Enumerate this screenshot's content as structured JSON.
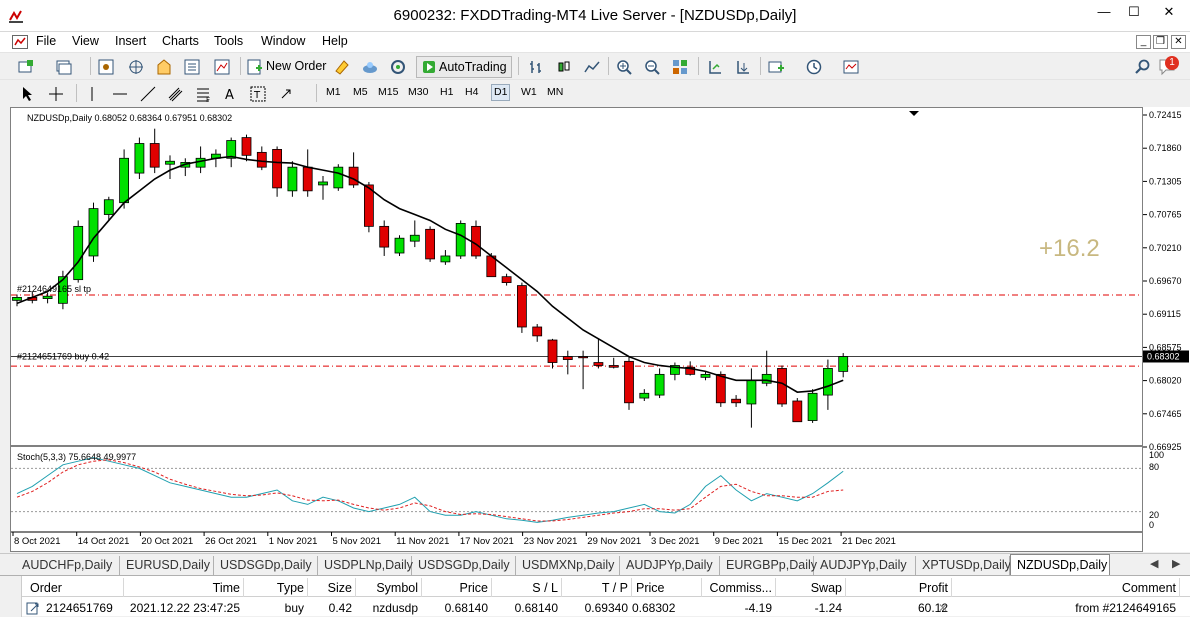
{
  "window": {
    "title": "6900232: FXDDTrading-MT4 Live Server - [NZDUSDp,Daily]",
    "min_label": "—",
    "max_label": "☐",
    "close_label": "✕"
  },
  "menu": [
    "File",
    "View",
    "Insert",
    "Charts",
    "Tools",
    "Window",
    "Help"
  ],
  "toolbar": {
    "new_order": "New Order",
    "auto_trading": "AutoTrading",
    "notification_count": "1"
  },
  "timeframes": [
    "M1",
    "M5",
    "M15",
    "M30",
    "H1",
    "H4",
    "D1",
    "W1",
    "MN"
  ],
  "active_timeframe": "D1",
  "chart": {
    "header": "NZDUSDp,Daily  0.68052 0.68364 0.67951 0.68302",
    "profit_overlay": "+16.2",
    "line_label_1": "#2124649165 sl tp",
    "line_label_2": "#2124651769 buy 0.42",
    "current_price_label": "0.68302",
    "stoch_label": "Stoch(5,3,3) 75.6648 49.9977",
    "price_scale": [
      "0.72415",
      "0.71860",
      "0.71305",
      "0.70765",
      "0.70210",
      "0.69670",
      "0.69115",
      "0.68575",
      "0.68020",
      "0.67465",
      "0.66925"
    ],
    "stoch_scale": [
      "100",
      "80",
      "20",
      "0"
    ],
    "date_labels": [
      "8 Oct 2021",
      "14 Oct 2021",
      "20 Oct 2021",
      "26 Oct 2021",
      "1 Nov 2021",
      "5 Nov 2021",
      "11 Nov 2021",
      "17 Nov 2021",
      "23 Nov 2021",
      "29 Nov 2021",
      "3 Dec 2021",
      "9 Dec 2021",
      "15 Dec 2021",
      "21 Dec 2021"
    ],
    "colors": {
      "bull": "#00e000",
      "bear": "#e00000",
      "ma": "#000000",
      "stoch_main": "#20a0b0",
      "stoch_signal": "#e02020",
      "dashed": "#e00000",
      "overlay": "#c8b880"
    }
  },
  "chart_data": {
    "type": "candlestick",
    "symbol": "NZDUSDp",
    "timeframe": "Daily",
    "ylim": [
      0.66925,
      0.72415
    ],
    "candles": [
      [
        0.6925,
        0.6935,
        0.6915,
        0.693
      ],
      [
        0.693,
        0.694,
        0.692,
        0.6925
      ],
      [
        0.6928,
        0.6938,
        0.692,
        0.6932
      ],
      [
        0.692,
        0.6975,
        0.691,
        0.6965
      ],
      [
        0.696,
        0.706,
        0.6955,
        0.705
      ],
      [
        0.7,
        0.709,
        0.699,
        0.708
      ],
      [
        0.707,
        0.71,
        0.706,
        0.7095
      ],
      [
        0.709,
        0.718,
        0.708,
        0.7165
      ],
      [
        0.714,
        0.72,
        0.713,
        0.719
      ],
      [
        0.719,
        0.7215,
        0.714,
        0.715
      ],
      [
        0.7155,
        0.717,
        0.713,
        0.716
      ],
      [
        0.715,
        0.7165,
        0.7135,
        0.7158
      ],
      [
        0.715,
        0.7185,
        0.714,
        0.7165
      ],
      [
        0.7165,
        0.718,
        0.715,
        0.7172
      ],
      [
        0.7165,
        0.72,
        0.715,
        0.7195
      ],
      [
        0.72,
        0.7205,
        0.716,
        0.717
      ],
      [
        0.7175,
        0.7185,
        0.7145,
        0.715
      ],
      [
        0.718,
        0.7185,
        0.71,
        0.7115
      ],
      [
        0.711,
        0.716,
        0.71,
        0.715
      ],
      [
        0.715,
        0.718,
        0.71,
        0.711
      ],
      [
        0.712,
        0.7135,
        0.7095,
        0.7125
      ],
      [
        0.7115,
        0.7155,
        0.711,
        0.715
      ],
      [
        0.715,
        0.7175,
        0.7115,
        0.712
      ],
      [
        0.712,
        0.7125,
        0.704,
        0.705
      ],
      [
        0.705,
        0.706,
        0.7,
        0.7015
      ],
      [
        0.7005,
        0.7035,
        0.7,
        0.703
      ],
      [
        0.7025,
        0.706,
        0.7015,
        0.7035
      ],
      [
        0.7045,
        0.705,
        0.699,
        0.6995
      ],
      [
        0.699,
        0.701,
        0.6985,
        0.7
      ],
      [
        0.7,
        0.706,
        0.6995,
        0.7055
      ],
      [
        0.705,
        0.706,
        0.6995,
        0.7
      ],
      [
        0.7,
        0.7005,
        0.6965,
        0.6965
      ],
      [
        0.6965,
        0.697,
        0.695,
        0.6955
      ],
      [
        0.695,
        0.6955,
        0.687,
        0.688
      ],
      [
        0.688,
        0.6885,
        0.6855,
        0.6865
      ],
      [
        0.6858,
        0.686,
        0.681,
        0.682
      ],
      [
        0.683,
        0.684,
        0.68,
        0.6825
      ],
      [
        0.683,
        0.684,
        0.6775,
        0.6828
      ],
      [
        0.682,
        0.686,
        0.681,
        0.6815
      ],
      [
        0.6815,
        0.6828,
        0.681,
        0.6812
      ],
      [
        0.6822,
        0.683,
        0.674,
        0.6752
      ],
      [
        0.676,
        0.6775,
        0.6755,
        0.6768
      ],
      [
        0.6765,
        0.681,
        0.676,
        0.68
      ],
      [
        0.68,
        0.682,
        0.679,
        0.6815
      ],
      [
        0.6812,
        0.6822,
        0.6798,
        0.68
      ],
      [
        0.6795,
        0.6805,
        0.679,
        0.68
      ],
      [
        0.68,
        0.6805,
        0.6745,
        0.6752
      ],
      [
        0.6758,
        0.6765,
        0.6745,
        0.6752
      ],
      [
        0.675,
        0.681,
        0.671,
        0.679
      ],
      [
        0.6785,
        0.684,
        0.678,
        0.68
      ],
      [
        0.681,
        0.6815,
        0.6745,
        0.675
      ],
      [
        0.6755,
        0.676,
        0.672,
        0.672
      ],
      [
        0.6722,
        0.6775,
        0.6718,
        0.6768
      ],
      [
        0.6765,
        0.6825,
        0.674,
        0.681
      ],
      [
        0.6805,
        0.6836,
        0.6795,
        0.683
      ]
    ],
    "ma": [
      0.692,
      0.693,
      0.694,
      0.696,
      0.699,
      0.703,
      0.706,
      0.709,
      0.711,
      0.713,
      0.7145,
      0.7155,
      0.716,
      0.7165,
      0.7168,
      0.7163,
      0.716,
      0.7158,
      0.7157,
      0.715,
      0.7145,
      0.714,
      0.713,
      0.7115,
      0.7095,
      0.708,
      0.707,
      0.706,
      0.7045,
      0.7035,
      0.702,
      0.7,
      0.698,
      0.696,
      0.694,
      0.6915,
      0.6895,
      0.6875,
      0.686,
      0.6845,
      0.683,
      0.682,
      0.6815,
      0.6812,
      0.681,
      0.6805,
      0.6797,
      0.679,
      0.679,
      0.679,
      0.6785,
      0.677,
      0.6772,
      0.678,
      0.679
    ],
    "stoch_main": [
      45,
      55,
      70,
      85,
      90,
      95,
      90,
      85,
      80,
      70,
      60,
      55,
      50,
      45,
      40,
      40,
      45,
      50,
      35,
      30,
      40,
      35,
      25,
      20,
      25,
      30,
      40,
      20,
      15,
      15,
      20,
      15,
      10,
      8,
      5,
      8,
      12,
      15,
      18,
      20,
      25,
      30,
      20,
      18,
      30,
      55,
      70,
      50,
      35,
      45,
      40,
      35,
      45,
      60,
      76
    ],
    "stoch_signal": [
      40,
      48,
      60,
      75,
      85,
      90,
      92,
      88,
      82,
      75,
      65,
      58,
      52,
      48,
      44,
      42,
      43,
      46,
      42,
      36,
      35,
      36,
      30,
      25,
      22,
      25,
      32,
      28,
      20,
      16,
      17,
      16,
      13,
      10,
      7,
      7,
      9,
      12,
      15,
      18,
      20,
      24,
      24,
      22,
      24,
      40,
      55,
      58,
      48,
      42,
      42,
      40,
      40,
      48,
      50
    ],
    "price_lines": {
      "current": 0.68302,
      "buy_entry": 0.6814,
      "sl_order": 0.6934
    },
    "stoch_levels": [
      80,
      20
    ]
  },
  "tabs": [
    "AUDCHFp,Daily",
    "EURUSD,Daily",
    "USDSGDp,Daily",
    "USDPLNp,Daily",
    "USDSGDp,Daily",
    "USDMXNp,Daily",
    "AUDJPYp,Daily",
    "EURGBPp,Daily",
    "AUDJPYp,Daily",
    "XPTUSDp,Daily",
    "NZDUSDp,Daily"
  ],
  "active_tab": "NZDUSDp,Daily",
  "terminal": {
    "headers": [
      "Order",
      "Time",
      "Type",
      "Size",
      "Symbol",
      "Price",
      "S / L",
      "T / P",
      "Price",
      "Commiss...",
      "Swap",
      "Profit",
      "Comment"
    ],
    "row": [
      "2124651769",
      "2021.12.22 23:47:25",
      "buy",
      "0.42",
      "nzdusdp",
      "0.68140",
      "0.68140",
      "0.69340",
      "0.68302",
      "-4.19",
      "-1.24",
      "60.12",
      "from #2124649165"
    ]
  }
}
